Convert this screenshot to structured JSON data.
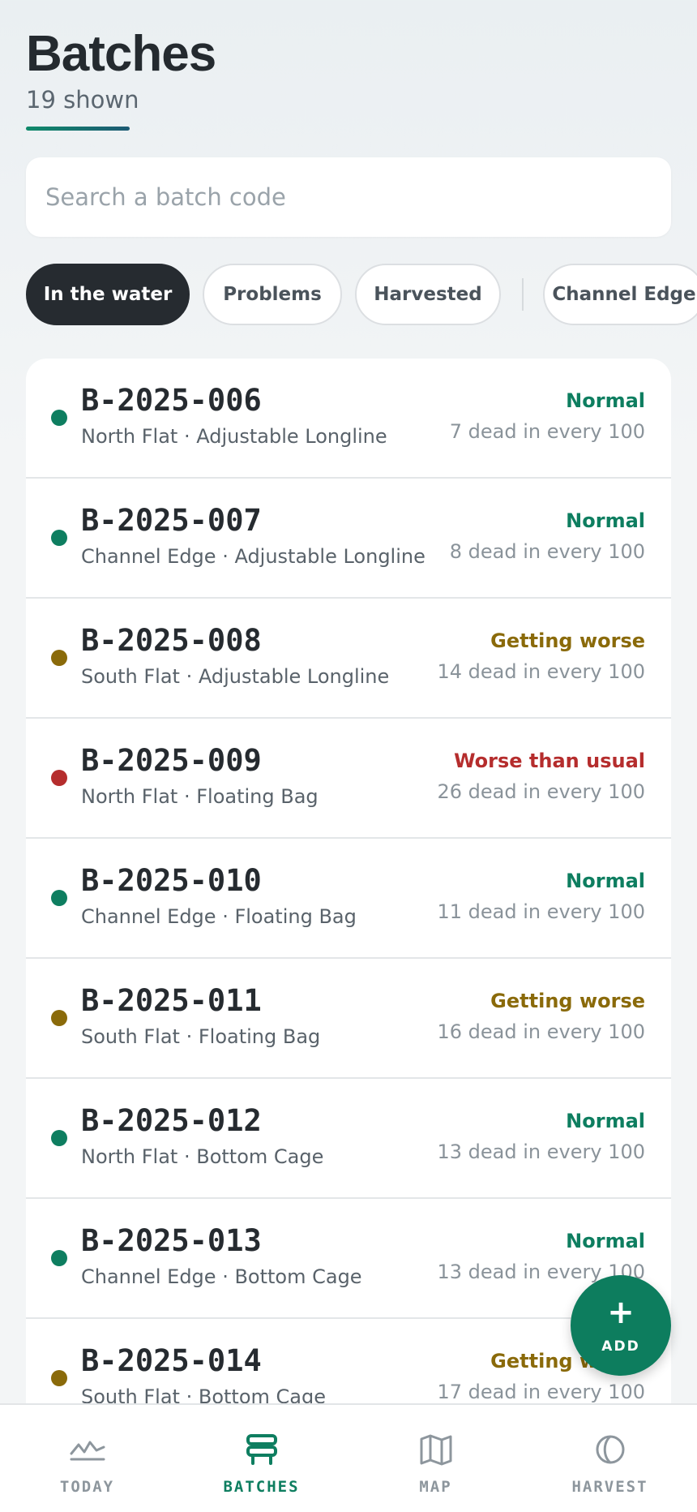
{
  "header": {
    "title": "Batches",
    "subtitle": "19 shown"
  },
  "search": {
    "placeholder": "Search a batch code",
    "value": ""
  },
  "filters": {
    "chips": [
      {
        "label": "In the water",
        "active": true
      },
      {
        "label": "Problems",
        "active": false
      },
      {
        "label": "Harvested",
        "active": false
      }
    ],
    "location_chips": [
      {
        "label": "Channel Edge",
        "active": false
      }
    ]
  },
  "colors": {
    "normal": "#0e7e60",
    "warning": "#8a6a0a",
    "bad": "#b52d2d",
    "accent": "#0d7d5e"
  },
  "batches": [
    {
      "code": "B-2025-006",
      "location": "North Flat · Adjustable Longline",
      "status": "Normal",
      "level": "normal",
      "rate": "7 dead in every 100"
    },
    {
      "code": "B-2025-007",
      "location": "Channel Edge · Adjustable Longline",
      "status": "Normal",
      "level": "normal",
      "rate": "8 dead in every 100"
    },
    {
      "code": "B-2025-008",
      "location": "South Flat · Adjustable Longline",
      "status": "Getting worse",
      "level": "warning",
      "rate": "14 dead in every 100"
    },
    {
      "code": "B-2025-009",
      "location": "North Flat · Floating Bag",
      "status": "Worse than usual",
      "level": "bad",
      "rate": "26 dead in every 100"
    },
    {
      "code": "B-2025-010",
      "location": "Channel Edge · Floating Bag",
      "status": "Normal",
      "level": "normal",
      "rate": "11 dead in every 100"
    },
    {
      "code": "B-2025-011",
      "location": "South Flat · Floating Bag",
      "status": "Getting worse",
      "level": "warning",
      "rate": "16 dead in every 100"
    },
    {
      "code": "B-2025-012",
      "location": "North Flat · Bottom Cage",
      "status": "Normal",
      "level": "normal",
      "rate": "13 dead in every 100"
    },
    {
      "code": "B-2025-013",
      "location": "Channel Edge · Bottom Cage",
      "status": "Normal",
      "level": "normal",
      "rate": "13 dead in every 100"
    },
    {
      "code": "B-2025-014",
      "location": "South Flat · Bottom Cage",
      "status": "Getting worse",
      "level": "warning",
      "rate": "17 dead in every 100"
    }
  ],
  "fab": {
    "icon": "plus-icon",
    "label": "ADD"
  },
  "nav": [
    {
      "label": "TODAY",
      "icon": "pulse-icon",
      "active": false
    },
    {
      "label": "BATCHES",
      "icon": "stack-icon",
      "active": true
    },
    {
      "label": "MAP",
      "icon": "map-icon",
      "active": false
    },
    {
      "label": "HARVEST",
      "icon": "moon-icon",
      "active": false
    }
  ]
}
